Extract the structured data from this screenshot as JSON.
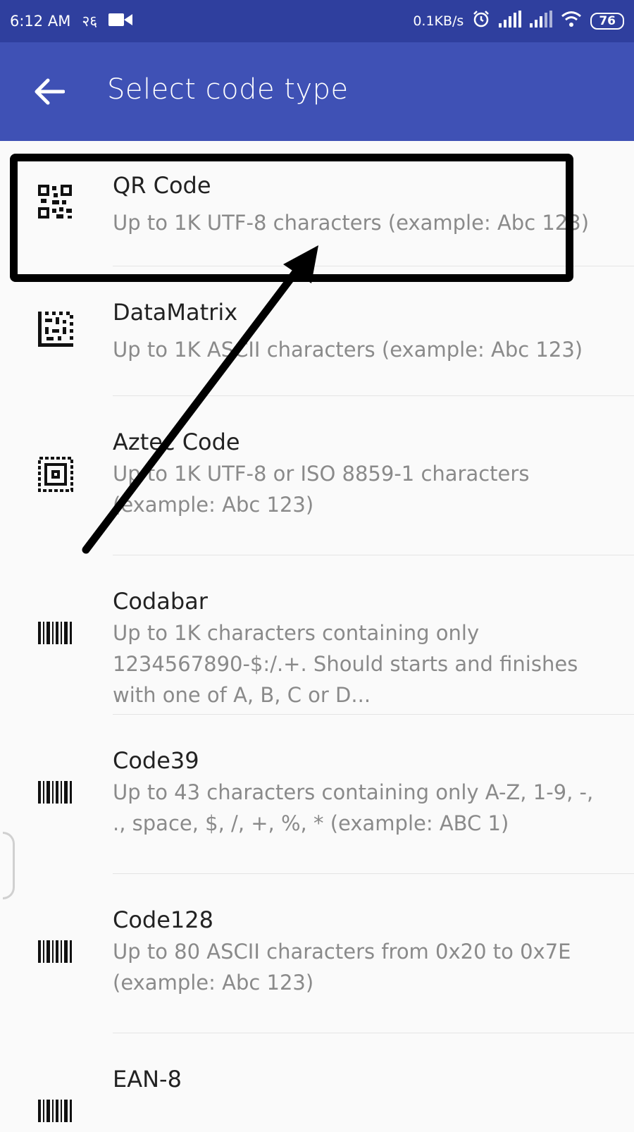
{
  "status_bar": {
    "time": "6:12 AM",
    "carrier_text": "२६",
    "speed": "0.1KB/s",
    "battery": "76"
  },
  "app_bar": {
    "title": "Select code type"
  },
  "items": [
    {
      "title": "QR Code",
      "desc": "Up to 1K UTF-8 characters (example: Abc 123)"
    },
    {
      "title": "DataMatrix",
      "desc": "Up to 1K ASCII characters (example: Abc 123)"
    },
    {
      "title": "Aztec Code",
      "desc": "Up to 1K UTF-8 or ISO 8859-1 characters (example: Abc 123)"
    },
    {
      "title": "Codabar",
      "desc": "Up to 1K characters containing only 1234567890-$:/.+. Should starts and finishes with one of A, B, C or D..."
    },
    {
      "title": "Code39",
      "desc": "Up to 43 characters containing only A-Z, 1-9, -, ., space, $, /, +, %, * (example: ABC 1)"
    },
    {
      "title": "Code128",
      "desc": "Up to 80 ASCII characters from 0x20 to 0x7E (example: Abc 123)"
    },
    {
      "title": "EAN-8",
      "desc": ""
    }
  ]
}
